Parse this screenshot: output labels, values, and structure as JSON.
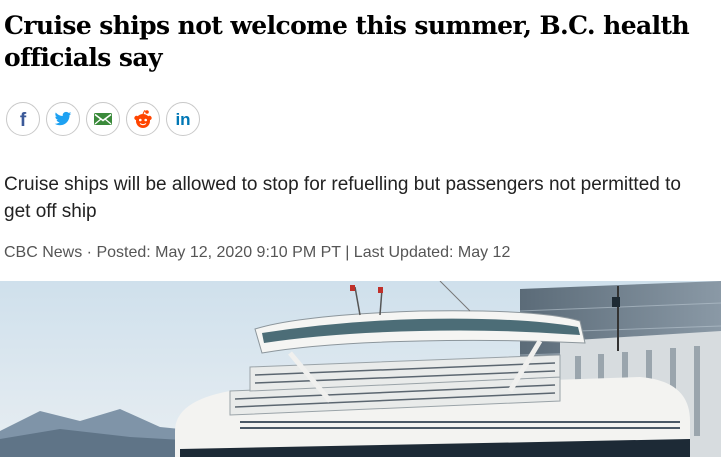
{
  "article": {
    "headline": "Cruise ships not welcome this summer, B.C. health officials say",
    "dek": "Cruise ships will be allowed to stop for refuelling but passengers not permitted to get off ship",
    "byline": {
      "source": "CBC News",
      "separator": " · ",
      "posted": "Posted: May 12, 2020 9:10 PM PT",
      "divider": " | ",
      "updated": "Last Updated: May 12"
    }
  },
  "share": [
    {
      "icon": "facebook-icon",
      "label": "f",
      "color": "#3b5998"
    },
    {
      "icon": "twitter-icon",
      "color": "#1da1f2"
    },
    {
      "icon": "email-icon",
      "color": "#3a8a3a"
    },
    {
      "icon": "reddit-icon",
      "color": "#ff4500"
    },
    {
      "icon": "linkedin-icon",
      "label": "in",
      "color": "#0077b5"
    }
  ]
}
